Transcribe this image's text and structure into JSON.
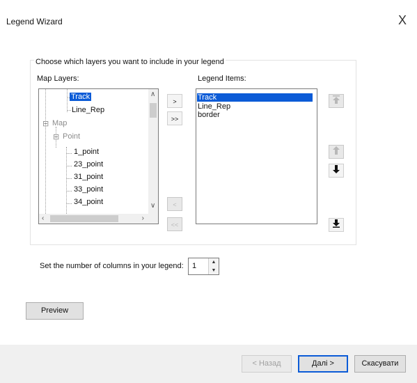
{
  "window": {
    "title": "Legend Wizard",
    "close_label": "X"
  },
  "instruction": "Choose which layers you want to include in your legend",
  "map_layers": {
    "label": "Map Layers:",
    "items": [
      {
        "text": "Track",
        "selected": true,
        "dimmed": false
      },
      {
        "text": "Line_Rep",
        "selected": false,
        "dimmed": false
      },
      {
        "text": "Map",
        "selected": false,
        "dimmed": true
      },
      {
        "text": "Point",
        "selected": false,
        "dimmed": true
      },
      {
        "text": "1_point",
        "selected": false,
        "dimmed": false
      },
      {
        "text": "23_point",
        "selected": false,
        "dimmed": false
      },
      {
        "text": "31_point",
        "selected": false,
        "dimmed": false
      },
      {
        "text": "33_point",
        "selected": false,
        "dimmed": false
      },
      {
        "text": "34_point",
        "selected": false,
        "dimmed": false
      }
    ],
    "expander_minus": "⊟"
  },
  "transfer_buttons": {
    "add": ">",
    "add_all": ">>",
    "remove": "<",
    "remove_all": "<<"
  },
  "legend_items": {
    "label": "Legend Items:",
    "items": [
      {
        "text": "Track",
        "selected": true
      },
      {
        "text": "Line_Rep",
        "selected": false
      },
      {
        "text": "border",
        "selected": false
      }
    ]
  },
  "order_buttons": {
    "top_icon": "arrow-to-top-icon",
    "up_icon": "arrow-up-icon",
    "down_icon": "arrow-down-icon",
    "bottom_icon": "arrow-to-bottom-icon"
  },
  "columns": {
    "label": "Set the number of columns in your legend:",
    "value": "1"
  },
  "preview_label": "Preview",
  "footer": {
    "back_label": "< Назад",
    "next_label": "Далі >",
    "cancel_label": "Скасувати"
  },
  "colors": {
    "selection": "#0b5bd7",
    "default_border": "#0b5bd7"
  }
}
